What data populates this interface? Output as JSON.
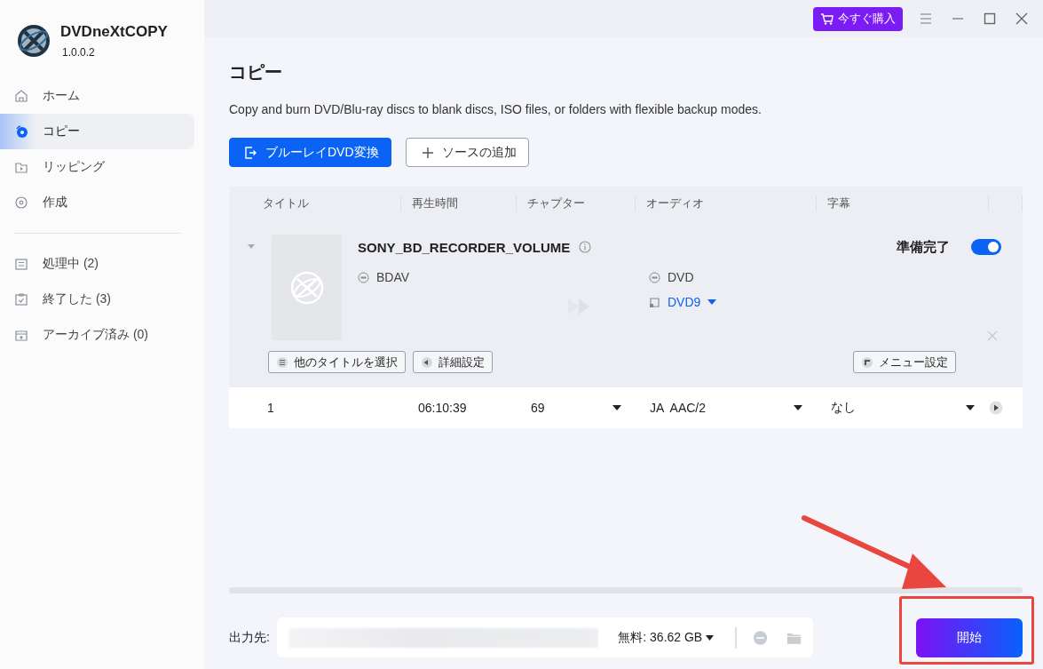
{
  "app": {
    "name": "DVDneXtCOPY",
    "version": "1.0.0.2"
  },
  "title_bar": {
    "buy_button": "今すぐ購入"
  },
  "sidebar": {
    "items": [
      {
        "label": "ホーム",
        "selected": false
      },
      {
        "label": "コピー",
        "selected": true
      },
      {
        "label": "リッピング",
        "selected": false
      },
      {
        "label": "作成",
        "selected": false
      }
    ],
    "queue_items": [
      {
        "label": "処理中 (2)",
        "selected": false
      },
      {
        "label": "終了した (3)",
        "selected": false
      },
      {
        "label": "アーカイブ済み (0)",
        "selected": false
      }
    ]
  },
  "page": {
    "title": "コピー",
    "description": "Copy and burn DVD/Blu-ray discs to blank discs, ISO files, or folders with flexible backup modes.",
    "buttons": [
      {
        "label": "ブルーレイDVD変換",
        "kind": "primary"
      },
      {
        "label": "ソースの追加",
        "kind": "secondary"
      }
    ]
  },
  "table": {
    "columns": [
      "タイトル",
      "再生時間",
      "チャプター",
      "オーディオ",
      "字幕"
    ],
    "source": {
      "name": "SONY_BD_RECORDER_VOLUME",
      "expanded": true,
      "status": "準備完了",
      "enabled": true,
      "source_format": "BDAV",
      "target_format": "DVD",
      "target_size": "DVD9",
      "actions": [
        "他のタイトルを選択",
        "詳細設定"
      ],
      "menu_button": "メニュー設定"
    },
    "rows": [
      {
        "cells": [
          {
            "text": "1",
            "dropdown": false
          },
          {
            "text": "06:10:39",
            "dropdown": false
          },
          {
            "text": "69",
            "dropdown": true
          },
          {
            "text": "JA  AAC/2",
            "dropdown": true
          },
          {
            "text": "なし",
            "dropdown": true
          }
        ]
      }
    ]
  },
  "output": {
    "label": "出力先:",
    "free_space": "無料: 36.62 GB"
  },
  "start_button": "開始"
}
